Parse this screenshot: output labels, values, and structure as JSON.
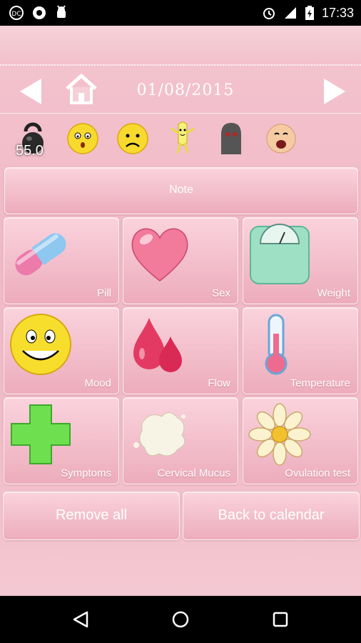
{
  "status_bar": {
    "time": "17:33"
  },
  "header": {
    "date": "01/08/2015"
  },
  "quick_icons": {
    "weight_value": "55.0"
  },
  "note_button": {
    "label": "Note"
  },
  "tiles": [
    {
      "label": "Pill"
    },
    {
      "label": "Sex"
    },
    {
      "label": "Weight"
    },
    {
      "label": "Mood"
    },
    {
      "label": "Flow"
    },
    {
      "label": "Temperature"
    },
    {
      "label": "Symptoms"
    },
    {
      "label": "Cervical Mucus"
    },
    {
      "label": "Ovulation test"
    }
  ],
  "footer_buttons": {
    "remove_all": "Remove all",
    "back_to_calendar": "Back to calendar"
  }
}
